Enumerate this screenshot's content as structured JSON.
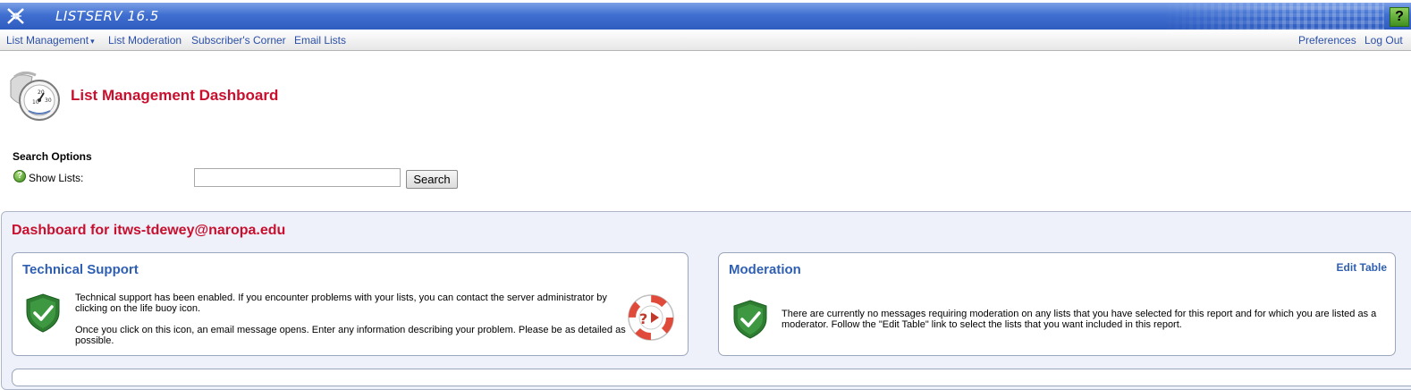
{
  "app": {
    "title": "LISTSERV 16.5",
    "help_label": "?"
  },
  "nav": {
    "items": [
      {
        "label": "List Management",
        "caret": "▾"
      },
      {
        "label": "List Moderation"
      },
      {
        "label": "Subscriber's Corner"
      },
      {
        "label": "Email Lists"
      }
    ],
    "right": [
      {
        "label": "Preferences"
      },
      {
        "label": "Log Out"
      }
    ]
  },
  "page": {
    "title": "List Management Dashboard"
  },
  "search": {
    "heading": "Search Options",
    "help_label": "?",
    "label": "Show Lists:",
    "value": "",
    "button_label": "Search"
  },
  "dashboard": {
    "title": "Dashboard for itws-tdewey@naropa.edu",
    "technical_support": {
      "title": "Technical Support",
      "paragraph1": "Technical support has been enabled. If you encounter problems with your lists, you can contact the server administrator by clicking on the life buoy icon.",
      "paragraph2": "Once you click on this icon, an email message opens. Enter any information describing your problem. Please be as detailed as possible."
    },
    "moderation": {
      "title": "Moderation",
      "edit_link": "Edit Table",
      "text": "There are currently no messages requiring moderation on any lists that you have selected for this report and for which you are listed as a moderator. Follow the \"Edit Table\" link to select the lists that you want included in this report."
    }
  },
  "colors": {
    "banner": "#3f6fd0",
    "title_red": "#c8102e",
    "link_blue": "#2a4fa8",
    "panel_title_blue": "#2f5fb3",
    "shield_green": "#2e7d32"
  }
}
